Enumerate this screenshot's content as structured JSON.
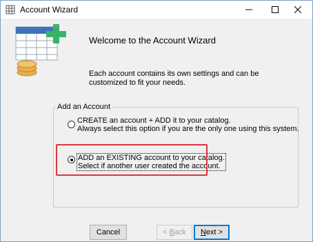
{
  "window": {
    "title": "Account Wizard",
    "controls": {
      "minimize": "—",
      "maximize": "☐",
      "close": "✕"
    }
  },
  "header": {
    "welcome": "Welcome to the Account Wizard",
    "description": "Each account contains its own settings and can be customized to fit your needs."
  },
  "group": {
    "label": "Add an Account",
    "options": [
      {
        "line1": "CREATE an account + ADD it to your catalog.",
        "line2": "Always select this option if you are the only one using this system.",
        "selected": false
      },
      {
        "line1": "ADD an EXISTING account to your catalog.",
        "line2": "Select if another user created the account.",
        "selected": true
      }
    ]
  },
  "buttons": {
    "cancel": "Cancel",
    "back_mnemonic": "B",
    "back_rest": "ack",
    "back_prefix": "< ",
    "next_mnemonic": "N",
    "next_rest": "ext",
    "next_suffix": " >"
  },
  "colors": {
    "highlight": "#d9363e",
    "default_button_border": "#0078d7",
    "icon_green": "#38b36c",
    "icon_blue": "#3b74b8",
    "coin": "#e8b04a"
  }
}
